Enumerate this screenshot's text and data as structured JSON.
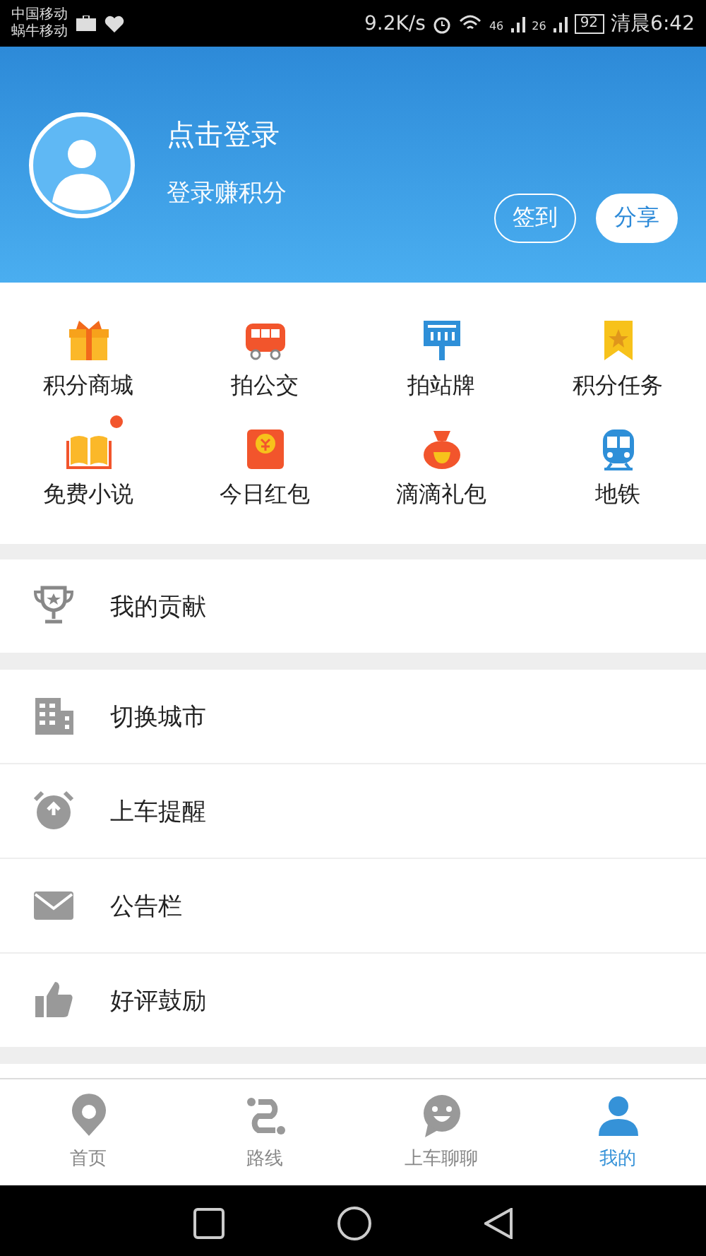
{
  "status_bar": {
    "carriers": [
      "中国移动",
      "蜗牛移动"
    ],
    "speed": "9.2K/s",
    "network_1": "46",
    "network_2": "26",
    "battery": "92",
    "time": "清晨6:42"
  },
  "profile": {
    "title": "点击登录",
    "subtitle": "登录赚积分",
    "buttons": [
      "签到",
      "分享"
    ]
  },
  "shortcuts": [
    {
      "label": "积分商城",
      "dot": false
    },
    {
      "label": "拍公交",
      "dot": false
    },
    {
      "label": "拍站牌",
      "dot": false
    },
    {
      "label": "积分任务",
      "dot": false
    },
    {
      "label": "免费小说",
      "dot": true
    },
    {
      "label": "今日红包",
      "dot": false
    },
    {
      "label": "滴滴礼包",
      "dot": false
    },
    {
      "label": "地铁",
      "dot": false
    }
  ],
  "menu_groups": [
    [
      {
        "label": "我的贡献"
      }
    ],
    [
      {
        "label": "切换城市"
      },
      {
        "label": "上车提醒"
      },
      {
        "label": "公告栏"
      },
      {
        "label": "好评鼓励"
      }
    ]
  ],
  "tabs": [
    {
      "label": "首页",
      "selected": false
    },
    {
      "label": "路线",
      "selected": false
    },
    {
      "label": "上车聊聊",
      "selected": false
    },
    {
      "label": "我的",
      "selected": true
    }
  ]
}
